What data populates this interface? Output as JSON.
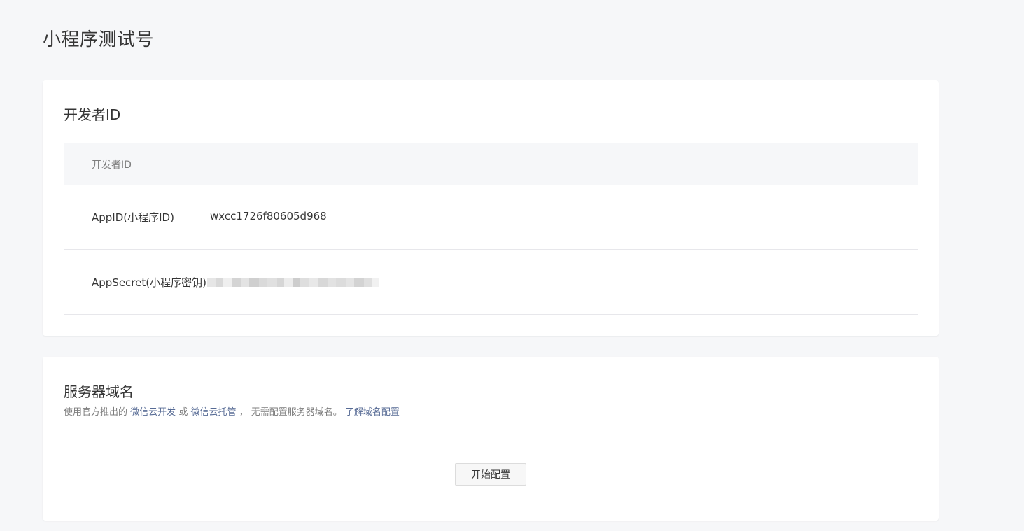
{
  "page": {
    "title": "小程序测试号"
  },
  "developer_id": {
    "title": "开发者ID",
    "table_header": "开发者ID",
    "rows": [
      {
        "label": "AppID(小程序ID)",
        "value": "wxcc1726f80605d968"
      },
      {
        "label": "AppSecret(小程序密钥)",
        "value_state": "masked"
      }
    ]
  },
  "server_domain": {
    "title": "服务器域名",
    "desc_prefix": "使用官方推出的",
    "link_cloud_dev": "微信云开发",
    "desc_or": "或",
    "link_cloud_host": "微信云托管",
    "desc_suffix": "， 无需配置服务器域名。",
    "link_learn_more": "了解域名配置",
    "start_button": "开始配置"
  },
  "colors": {
    "background": "#f6f7f9",
    "card": "#ffffff",
    "link": "#576b95",
    "text": "#353535",
    "muted": "#7d7d7d"
  }
}
